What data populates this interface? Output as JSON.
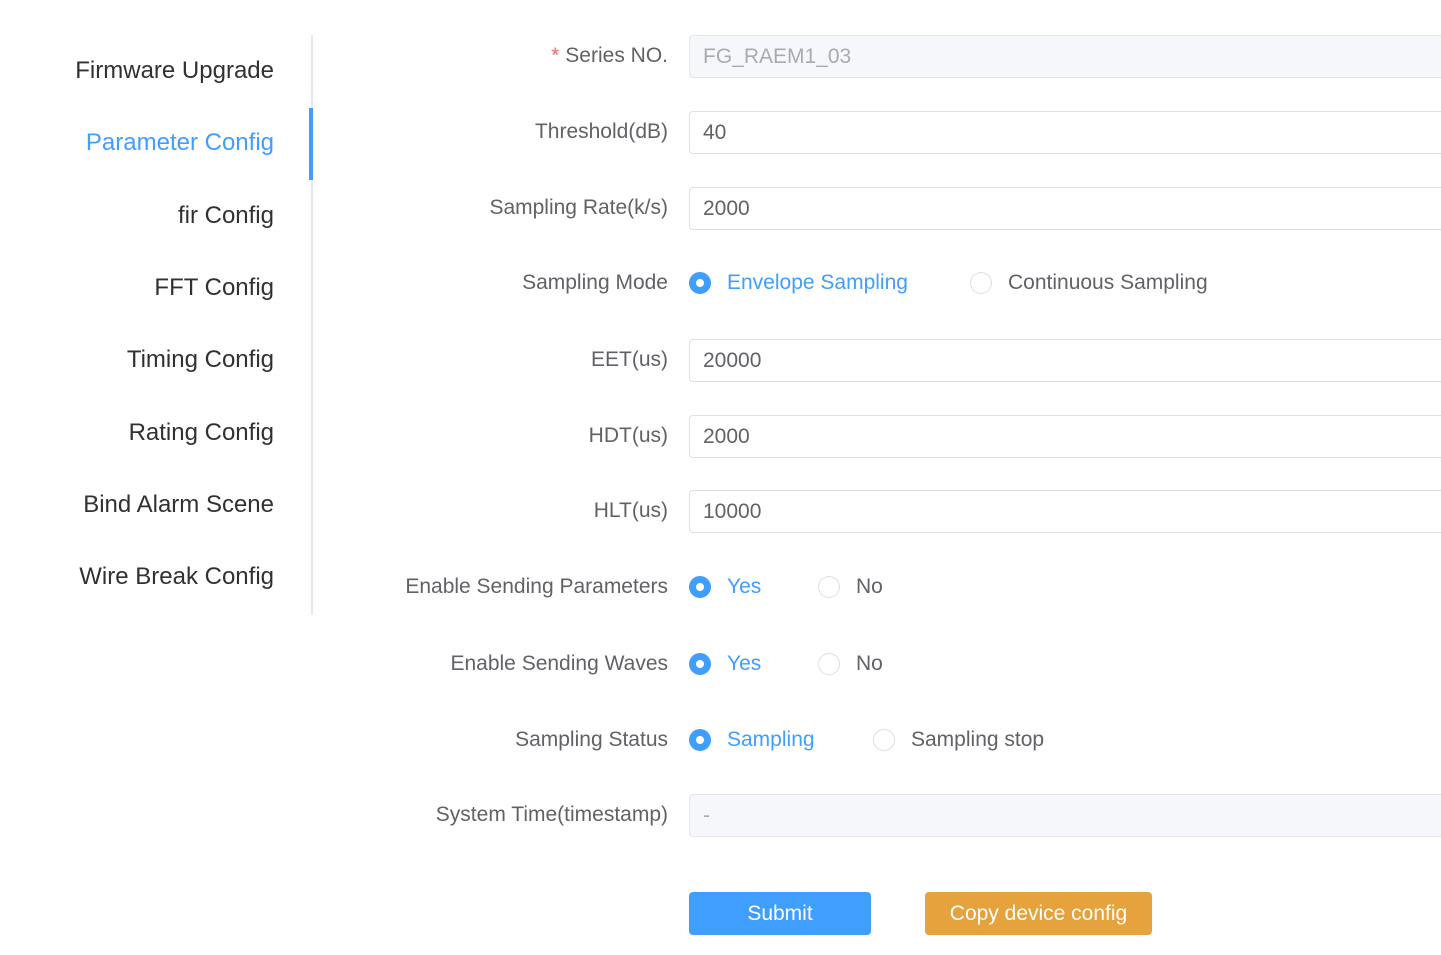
{
  "sidebar": {
    "items": [
      {
        "label": "Firmware Upgrade"
      },
      {
        "label": "Parameter Config"
      },
      {
        "label": "fir Config"
      },
      {
        "label": "FFT Config"
      },
      {
        "label": "Timing Config"
      },
      {
        "label": "Rating Config"
      },
      {
        "label": "Bind Alarm Scene"
      },
      {
        "label": "Wire Break Config"
      }
    ],
    "active_index": 1
  },
  "form": {
    "series_no": {
      "required_mark": "*",
      "label": "Series NO.",
      "value": "FG_RAEM1_03"
    },
    "threshold": {
      "label": "Threshold(dB)",
      "value": "40"
    },
    "sampling_rate": {
      "label": "Sampling Rate(k/s)",
      "value": "2000"
    },
    "sampling_mode": {
      "label": "Sampling Mode",
      "options": [
        "Envelope Sampling",
        "Continuous Sampling"
      ],
      "selected": "Envelope Sampling"
    },
    "eet": {
      "label": "EET(us)",
      "value": "20000"
    },
    "hdt": {
      "label": "HDT(us)",
      "value": "2000"
    },
    "hlt": {
      "label": "HLT(us)",
      "value": "10000"
    },
    "enable_sending_parameters": {
      "label": "Enable Sending Parameters",
      "options": [
        "Yes",
        "No"
      ],
      "selected": "Yes"
    },
    "enable_sending_waves": {
      "label": "Enable Sending Waves",
      "options": [
        "Yes",
        "No"
      ],
      "selected": "Yes"
    },
    "sampling_status": {
      "label": "Sampling Status",
      "options": [
        "Sampling",
        "Sampling stop"
      ],
      "selected": "Sampling"
    },
    "system_time": {
      "label": "System Time(timestamp)",
      "value": "-"
    }
  },
  "actions": {
    "submit_label": "Submit",
    "copy_label": "Copy device config"
  },
  "colors": {
    "primary": "#409eff",
    "warning": "#e6a23c",
    "required": "#f56c6c",
    "text": "#606266"
  }
}
